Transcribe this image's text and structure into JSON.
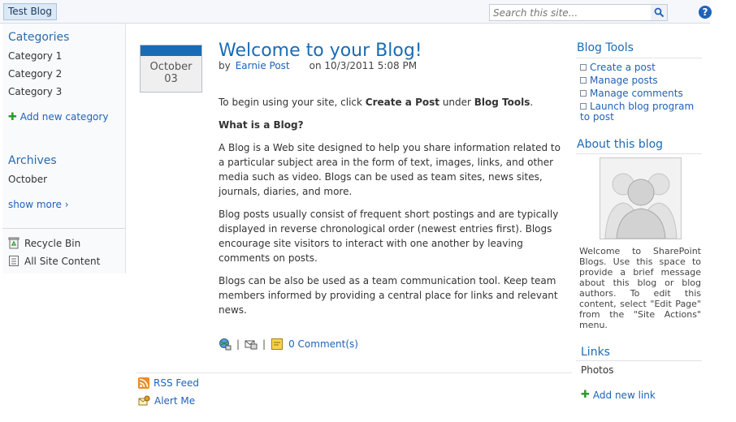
{
  "topbar": {
    "site_tab": "Test Blog",
    "search_placeholder": "Search this site...",
    "help_glyph": "?"
  },
  "leftnav": {
    "categories_heading": "Categories",
    "categories": [
      "Category 1",
      "Category 2",
      "Category 3"
    ],
    "add_category": "Add new category",
    "archives_heading": "Archives",
    "archives": [
      "October"
    ],
    "show_more": "show more ›",
    "recycle_bin": "Recycle Bin",
    "all_site_content": "All Site Content"
  },
  "post": {
    "date_month": "October",
    "date_day": "03",
    "title": "Welcome to your Blog!",
    "by": "by",
    "author": "Earnie Post",
    "posted_on": "on 10/3/2011 5:08 PM",
    "intro_pre": "To begin using your site, click ",
    "intro_bold1": "Create a Post",
    "intro_mid": " under ",
    "intro_bold2": "Blog Tools",
    "intro_post": ".",
    "what_is_heading": "What is a Blog?",
    "para1": "A Blog is a Web site designed to help you share information related to a particular subject area in the form of text, images, links, and other media such as video. Blogs can be used as team sites, news sites, journals, diaries, and more.",
    "para2": "Blog posts usually consist of frequent short postings and are typically displayed in reverse chronological order (newest entries first). Blogs encourage site visitors to interact with one another by leaving comments on posts.",
    "para3": "Blogs can be also be used as a team communication tool. Keep team members informed by providing a central place for links and relevant news.",
    "separator": "|",
    "comments": "0 Comment(s)"
  },
  "footer": {
    "rss": "RSS Feed",
    "alert": "Alert Me"
  },
  "right": {
    "tools_heading": "Blog Tools",
    "tools": [
      "Create a post",
      "Manage posts",
      "Manage comments",
      "Launch blog program to post"
    ],
    "about_heading": "About this blog",
    "about_text": "Welcome to SharePoint Blogs. Use this space to provide a brief message about this blog or blog authors. To edit this content, select \"Edit Page\" from the \"Site Actions\" menu.",
    "links_heading": "Links",
    "links": [
      "Photos"
    ],
    "add_link": "Add new link"
  },
  "colors": {
    "accent": "#1a6bb5",
    "link": "#1f62b8",
    "plus": "#2d9a2d"
  }
}
